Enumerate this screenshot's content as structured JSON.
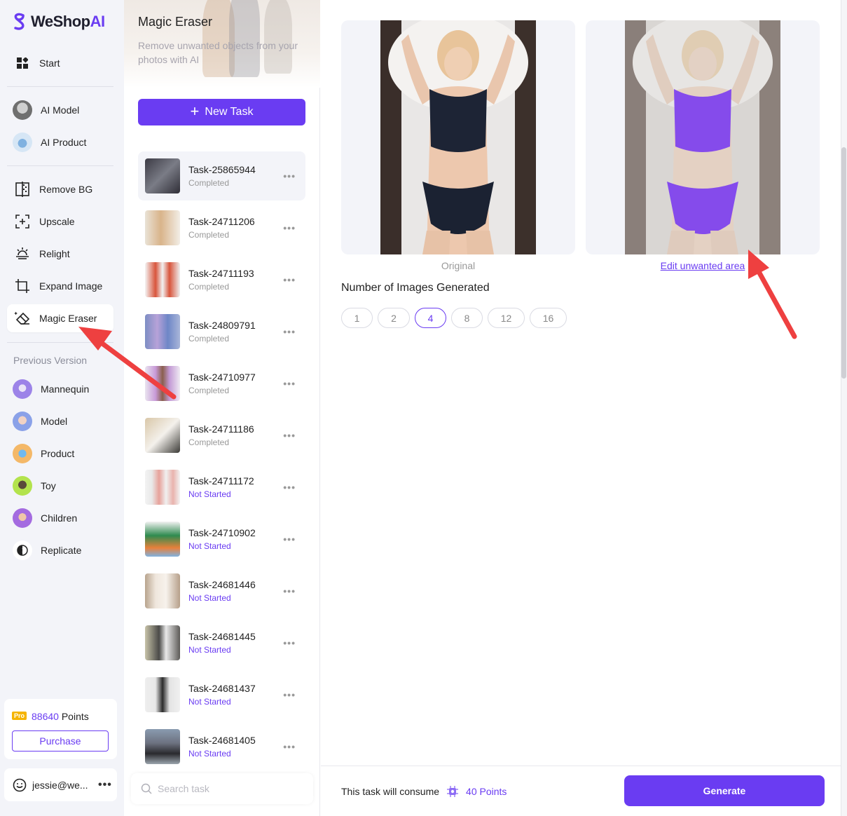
{
  "brand": {
    "name": "WeShop",
    "suffix": "AI"
  },
  "nav": {
    "top_items": [
      {
        "label": "Start",
        "icon": "grid-icon"
      }
    ],
    "ai_items": [
      {
        "label": "AI Model",
        "icon": "ai-model-avatar"
      },
      {
        "label": "AI Product",
        "icon": "ai-product-avatar"
      }
    ],
    "tool_items": [
      {
        "label": "Remove BG",
        "icon": "remove-bg-icon"
      },
      {
        "label": "Upscale",
        "icon": "upscale-icon"
      },
      {
        "label": "Relight",
        "icon": "relight-icon"
      },
      {
        "label": "Expand Image",
        "icon": "crop-icon"
      },
      {
        "label": "Magic Eraser",
        "icon": "eraser-icon",
        "active": true
      }
    ],
    "previous_label": "Previous Version",
    "previous_items": [
      {
        "label": "Mannequin"
      },
      {
        "label": "Model"
      },
      {
        "label": "Product"
      },
      {
        "label": "Toy"
      },
      {
        "label": "Children"
      },
      {
        "label": "Replicate"
      }
    ],
    "points": {
      "badge": "Pro",
      "value": "88640",
      "unit": "Points",
      "purchase_label": "Purchase"
    },
    "user": {
      "email": "jessie@we..."
    }
  },
  "tasks_panel": {
    "title": "Magic Eraser",
    "subtitle": "Remove unwanted objects from your photos with AI",
    "new_task_label": "New Task",
    "tasks": [
      {
        "name": "Task-25865944",
        "status": "Completed",
        "selected": true
      },
      {
        "name": "Task-24711206",
        "status": "Completed"
      },
      {
        "name": "Task-24711193",
        "status": "Completed"
      },
      {
        "name": "Task-24809791",
        "status": "Completed"
      },
      {
        "name": "Task-24710977",
        "status": "Completed"
      },
      {
        "name": "Task-24711186",
        "status": "Completed"
      },
      {
        "name": "Task-24711172",
        "status": "Not Started"
      },
      {
        "name": "Task-24710902",
        "status": "Not Started"
      },
      {
        "name": "Task-24681446",
        "status": "Not Started"
      },
      {
        "name": "Task-24681445",
        "status": "Not Started"
      },
      {
        "name": "Task-24681437",
        "status": "Not Started"
      },
      {
        "name": "Task-24681405",
        "status": "Not Started"
      }
    ],
    "search_placeholder": "Search task"
  },
  "main": {
    "original_caption": "Original",
    "edit_link": "Edit unwanted area",
    "count_label": "Number of Images Generated",
    "counts": [
      "1",
      "2",
      "4",
      "8",
      "12",
      "16"
    ],
    "selected_count": "4",
    "consume_text": "This task will consume",
    "consume_points": "40 Points",
    "generate_label": "Generate"
  },
  "colors": {
    "accent": "#6a3cf2",
    "annotation_arrow": "#ee4040",
    "nav_bg": "#f3f4f9"
  }
}
